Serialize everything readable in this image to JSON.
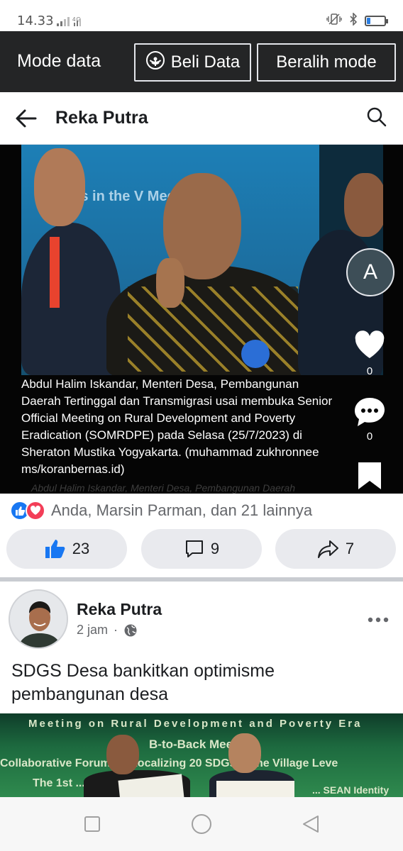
{
  "status_bar": {
    "time": "14.33",
    "signal": "4G",
    "battery_level": 0.2
  },
  "data_mode": {
    "title": "Mode data",
    "buy_data_label": "Beli Data",
    "switch_mode_label": "Beralih mode"
  },
  "header": {
    "page_name": "Reka Putra"
  },
  "media": {
    "caption": "Abdul Halim Iskandar, Menteri Desa, Pembangunan Daerah Tertinggal dan Transmigrasi usai membuka Senior Official Meeting on Rural Development and Poverty Eradication (SOMRDPE) pada Selasa (25/7/2023) di Sheraton Mustika Yogyakarta. (muhammad zukhronnee ms/koranbernas.id)",
    "caption_ghost": "Abdul Halim Iskandar, Menteri Desa, Pembangunan Daerah",
    "background_text": "SDGs in the V Meeting",
    "side_avatar_letter": "A",
    "like_count": "0",
    "comment_count": "0"
  },
  "post1": {
    "reaction_summary": "Anda, Marsin Parman, dan 21 lainnya",
    "likes": "23",
    "comments": "9",
    "shares": "7"
  },
  "post2": {
    "author": "Reka Putra",
    "time": "2 jam",
    "dot": "·",
    "text": "SDGS Desa bankitkan optimisme pembangunan desa",
    "banner_lines": [
      "Meeting on Rural Development and Poverty Era",
      "B-to-Back Meeting",
      "Collaborative Forum on Localizing 20 SDGs in the Village Leve",
      "The 1st ... Network ... eting",
      "... SEAN Identity"
    ]
  },
  "colors": {
    "fb_blue": "#1877f2",
    "love_red": "#f33e58",
    "dark_bar": "#242526"
  }
}
